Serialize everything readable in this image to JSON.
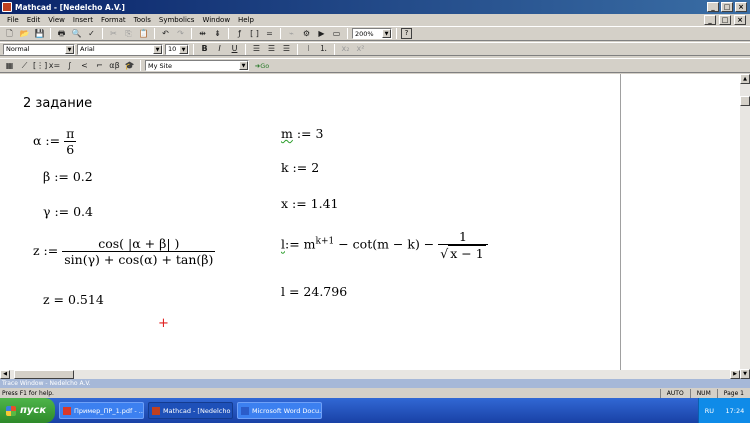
{
  "window": {
    "title": "Mathcad - [Nedelcho A.V.]",
    "buttons": [
      "_",
      "□",
      "×"
    ]
  },
  "menu": {
    "items": [
      "File",
      "Edit",
      "View",
      "Insert",
      "Format",
      "Tools",
      "Symbolics",
      "Window",
      "Help"
    ],
    "right_buttons": [
      "_",
      "□",
      "×"
    ]
  },
  "toolbar": {
    "zoom": "200%",
    "help": "?"
  },
  "format_bar": {
    "style": "Normal",
    "font": "Arial",
    "size": "10",
    "bold": "B",
    "italic": "I",
    "underline": "U"
  },
  "resources": {
    "site": "My Site",
    "go": "Go"
  },
  "document": {
    "heading": "2 задание",
    "alpha_lhs": "α :=",
    "alpha_num": "π",
    "alpha_den": "6",
    "beta": "β := 0.2",
    "gamma": "γ := 0.4",
    "z_lhs": "z :=",
    "z_num": "cos( |α + β| )",
    "z_den": "sin(γ) + cos(α) + tan(β)",
    "z_result": "z = 0.514",
    "m_var": "m",
    "m_rest": ":= 3",
    "k": "k := 2",
    "x": "x := 1.41",
    "l_var": "l",
    "l_assign": ":= m",
    "l_exp": "k+1",
    "l_mid": " − cot(m − k) − ",
    "l_num": "1",
    "l_den_prefix": "√",
    "l_den": "x − 1",
    "l_result": "l = 24.796",
    "cursor": "+"
  },
  "trace": {
    "label": "Trace Window - Nedelcho A.V."
  },
  "status": {
    "help": "Press F1 for help.",
    "auto": "AUTO",
    "num": "NUM",
    "page": "Page 1"
  },
  "taskbar": {
    "start": "пуск",
    "tasks": [
      {
        "label": "Пример_ПР_1.pdf - ...",
        "color": "#d9382a"
      },
      {
        "label": "Mathcad - [Nedelcho ...",
        "color": "#c04020"
      },
      {
        "label": "Microsoft Word Docu...",
        "color": "#2b5cc9"
      }
    ],
    "lang": "RU",
    "time": "17:24"
  }
}
